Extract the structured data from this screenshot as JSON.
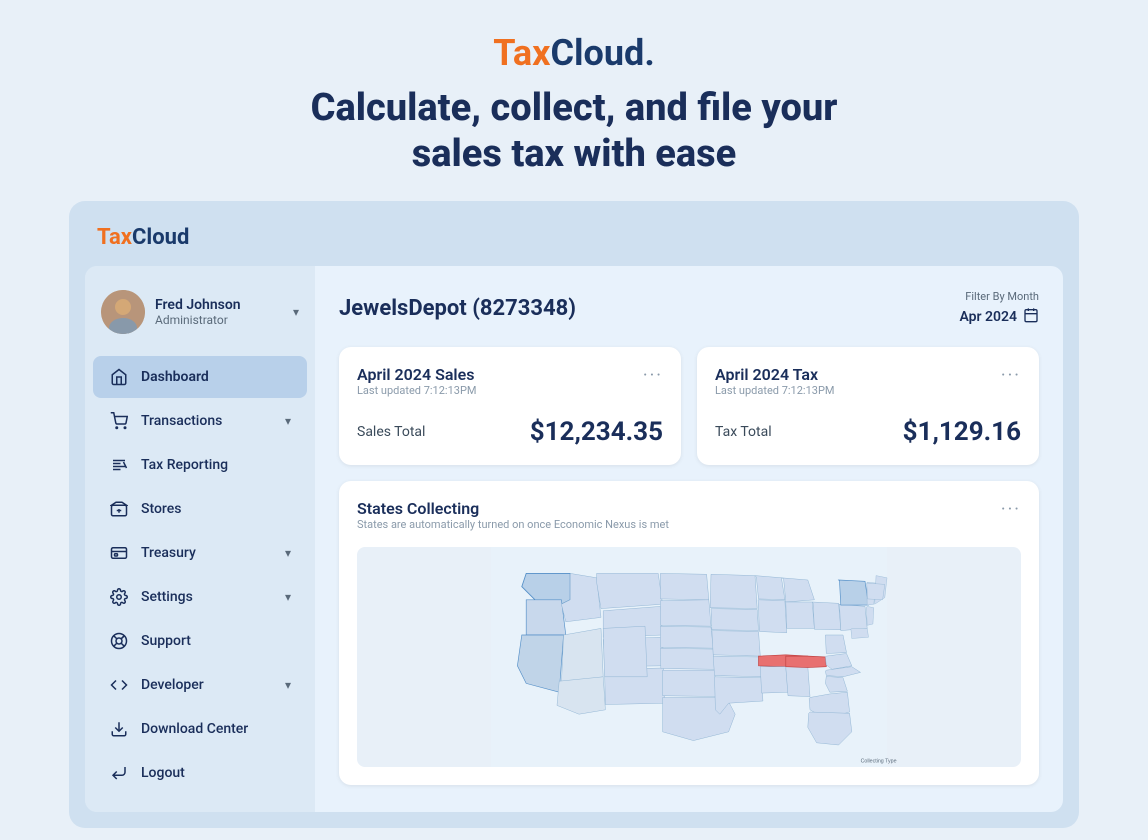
{
  "hero": {
    "logo_tax": "Tax",
    "logo_cloud": "Cloud",
    "logo_dot": ".",
    "tagline_line1": "Calculate, collect, and file your",
    "tagline_line2": "sales tax with ease"
  },
  "app": {
    "logo_tax": "Tax",
    "logo_cloud": "Cloud"
  },
  "sidebar": {
    "user": {
      "name": "Fred Johnson",
      "role": "Administrator"
    },
    "nav_items": [
      {
        "id": "dashboard",
        "label": "Dashboard",
        "active": true
      },
      {
        "id": "transactions",
        "label": "Transactions",
        "has_chevron": true
      },
      {
        "id": "tax-reporting",
        "label": "Tax Reporting",
        "has_chevron": false
      },
      {
        "id": "stores",
        "label": "Stores",
        "has_chevron": false
      },
      {
        "id": "treasury",
        "label": "Treasury",
        "has_chevron": true
      },
      {
        "id": "settings",
        "label": "Settings",
        "has_chevron": true
      },
      {
        "id": "support",
        "label": "Support",
        "has_chevron": false
      },
      {
        "id": "developer",
        "label": "Developer",
        "has_chevron": true
      },
      {
        "id": "download-center",
        "label": "Download Center",
        "has_chevron": false
      },
      {
        "id": "logout",
        "label": "Logout",
        "has_chevron": false
      }
    ]
  },
  "main": {
    "store_title": "JewelsDepot (8273348)",
    "filter_label": "Filter By Month",
    "filter_value": "Apr 2024",
    "sales_card": {
      "title": "April 2024 Sales",
      "subtitle": "Last updated 7:12:13PM",
      "metric_label": "Sales Total",
      "metric_value": "$12,234.35",
      "dots": "···"
    },
    "tax_card": {
      "title": "April 2024 Tax",
      "subtitle": "Last updated 7:12:13PM",
      "metric_label": "Tax Total",
      "metric_value": "$1,129.16",
      "dots": "···"
    },
    "states_card": {
      "title": "States Collecting",
      "subtitle": "States are automatically turned on once Economic Nexus is met",
      "dots": "···",
      "collecting_type_label": "Collecting Type"
    }
  }
}
